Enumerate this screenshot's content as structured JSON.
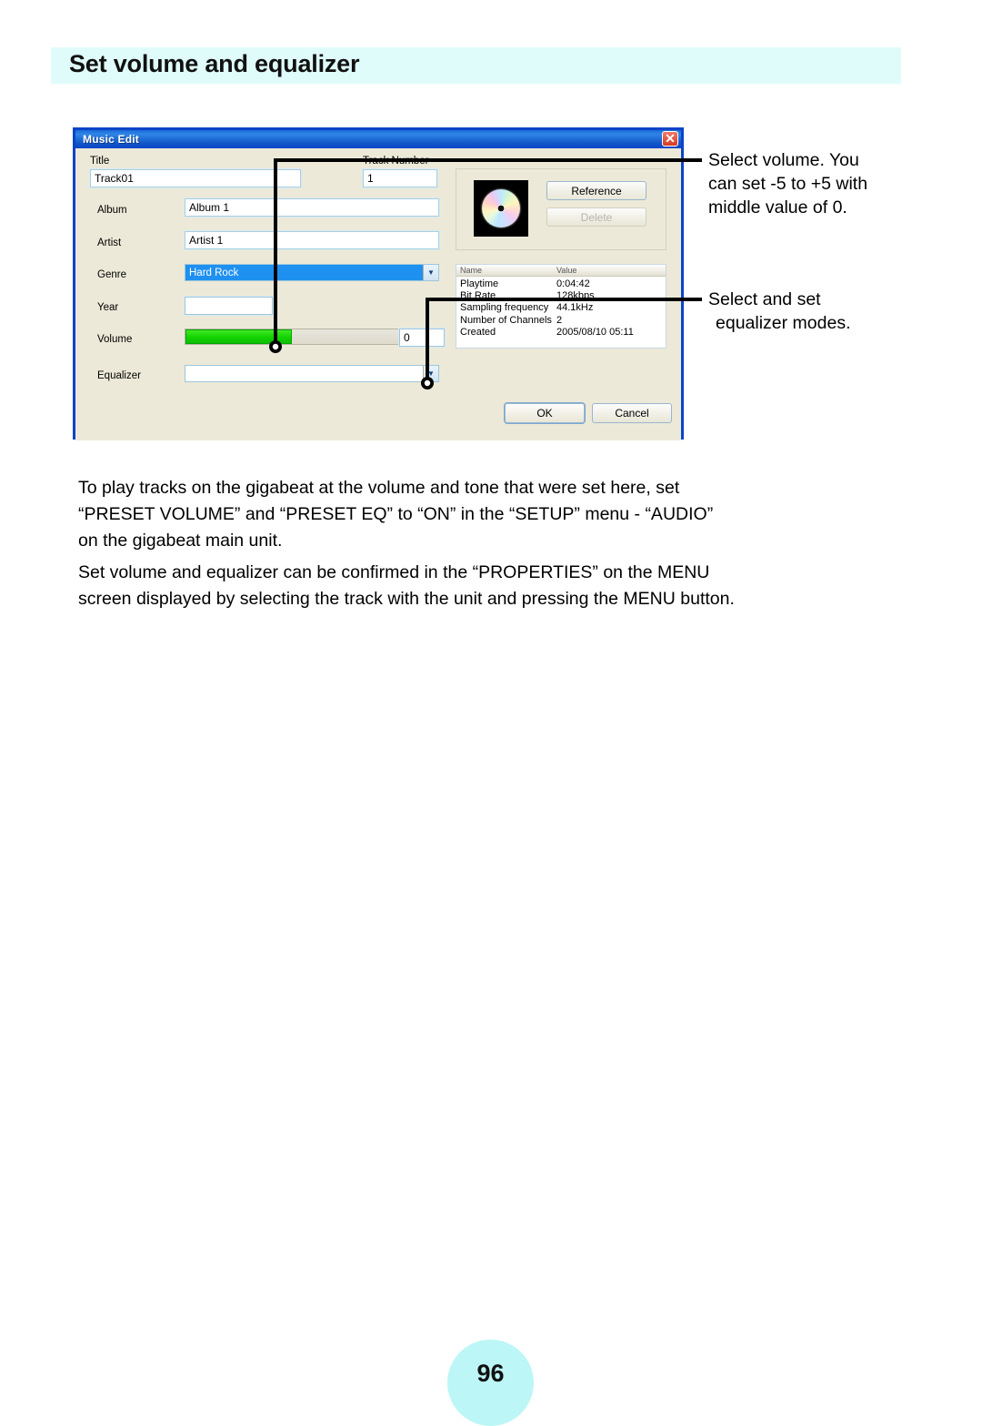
{
  "page": {
    "heading": "Set volume and equalizer",
    "number": "96",
    "accent_band_color": "#dffcfb",
    "page_circle_color": "#bdf6f6"
  },
  "dialog": {
    "title": "Music Edit",
    "close_icon": "close-icon",
    "fields": {
      "title_label": "Title",
      "title_value": "Track01",
      "track_number_label": "Track Number",
      "track_number_value": "1",
      "album_label": "Album",
      "album_value": "Album 1",
      "artist_label": "Artist",
      "artist_value": "Artist 1",
      "genre_label": "Genre",
      "genre_value": "Hard Rock",
      "year_label": "Year",
      "year_value": "",
      "volume_label": "Volume",
      "volume_value": "0",
      "equalizer_label": "Equalizer",
      "equalizer_value": ""
    },
    "artwork": {
      "icon": "cd-disc-icon",
      "reference_button": "Reference",
      "delete_button": "Delete"
    },
    "properties": {
      "header_name": "Name",
      "header_value": "Value",
      "rows": [
        {
          "key": "Playtime",
          "value": "0:04:42"
        },
        {
          "key": "Bit Rate",
          "value": "128kbps"
        },
        {
          "key": "Sampling frequency",
          "value": "44.1kHz"
        },
        {
          "key": "Number of Channels",
          "value": "2"
        },
        {
          "key": "Created",
          "value": "2005/08/10 05:11"
        }
      ]
    },
    "footer": {
      "ok_button": "OK",
      "cancel_button": "Cancel"
    }
  },
  "callouts": {
    "volume_note_line1": "Select volume. You",
    "volume_note_line2": "can set -5 to +5 with",
    "volume_note_line3": "middle value of 0.",
    "equalizer_note_line1": "Select and set",
    "equalizer_note_line2": "equalizer modes."
  },
  "body": {
    "paragraph1_line1": "To play tracks on the gigabeat at the volume and tone that were set here, set",
    "paragraph1_line2": "“PRESET VOLUME” and “PRESET EQ” to “ON” in the “SETUP” menu - “AUDIO”",
    "paragraph1_line3": "on the gigabeat main unit.",
    "paragraph2_line1": "Set volume and equalizer can be confirmed in the “PROPERTIES” on the MENU",
    "paragraph2_line2": "screen displayed by selecting the track with the unit and pressing the MENU button."
  }
}
